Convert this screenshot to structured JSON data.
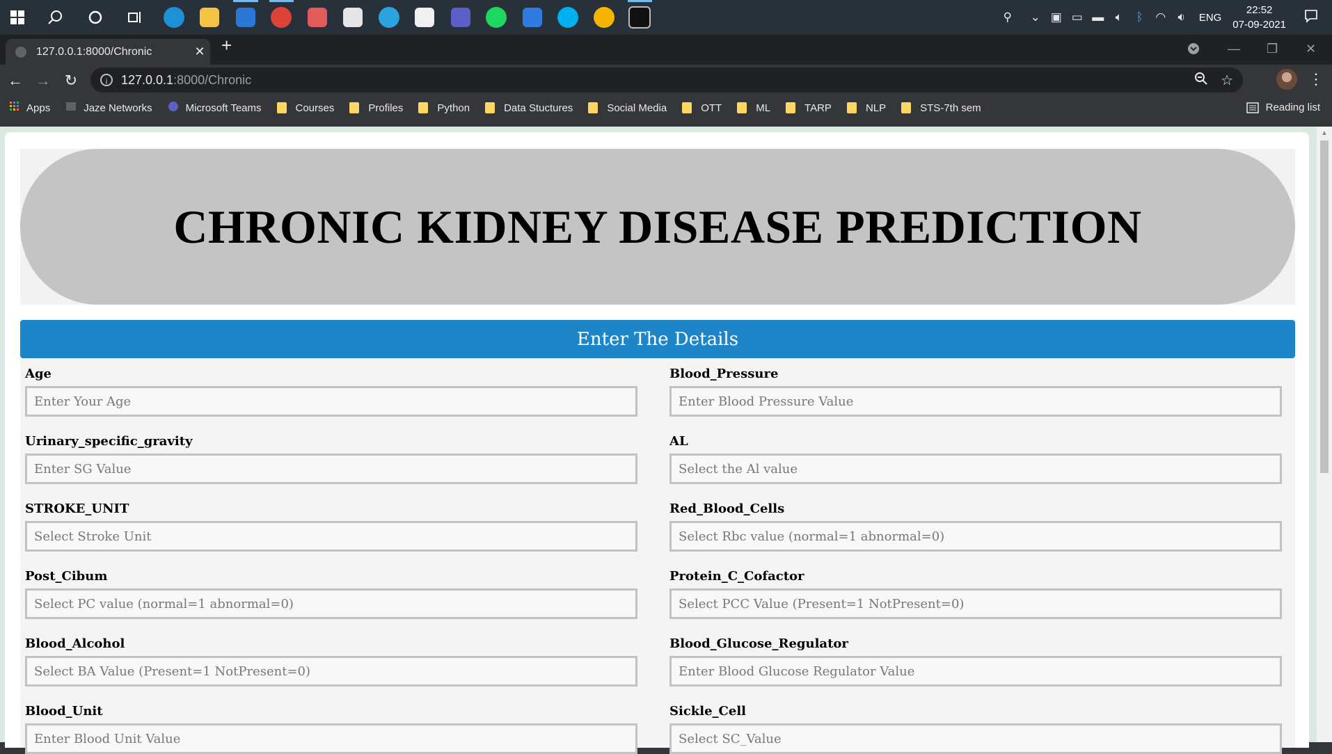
{
  "taskbar": {
    "apps": [
      {
        "name": "edge",
        "color": "#1e90d6"
      },
      {
        "name": "file-explorer",
        "color": "#f2c344"
      },
      {
        "name": "mail",
        "color": "#2a78d6"
      },
      {
        "name": "chrome",
        "color": "#db4437"
      },
      {
        "name": "paint",
        "color": "#e35a5a"
      },
      {
        "name": "settings",
        "color": "#e6e6e6"
      },
      {
        "name": "telegram",
        "color": "#2aa3df"
      },
      {
        "name": "store",
        "color": "#f0f0f0"
      },
      {
        "name": "teams",
        "color": "#5b5fc7"
      },
      {
        "name": "spotify",
        "color": "#1ed760"
      },
      {
        "name": "todo",
        "color": "#2f7be0"
      },
      {
        "name": "skype",
        "color": "#00aff0"
      },
      {
        "name": "weather",
        "color": "#f5b400"
      },
      {
        "name": "terminal",
        "color": "#111111"
      }
    ],
    "lang": "ENG",
    "time": "22:52",
    "date": "07-09-2021"
  },
  "browser": {
    "tab_title": "127.0.0.1:8000/Chronic",
    "url_host": "127.0.0.1",
    "url_rest": ":8000/Chronic",
    "bookmarks": [
      {
        "label": "Apps",
        "type": "apps"
      },
      {
        "label": "Jaze Networks",
        "type": "site"
      },
      {
        "label": "Microsoft Teams",
        "type": "site"
      },
      {
        "label": "Courses",
        "type": "folder"
      },
      {
        "label": "Profiles",
        "type": "folder"
      },
      {
        "label": "Python",
        "type": "folder"
      },
      {
        "label": "Data Stuctures",
        "type": "folder"
      },
      {
        "label": "Social Media",
        "type": "folder"
      },
      {
        "label": "OTT",
        "type": "folder"
      },
      {
        "label": "ML",
        "type": "folder"
      },
      {
        "label": "TARP",
        "type": "folder"
      },
      {
        "label": "NLP",
        "type": "folder"
      },
      {
        "label": "STS-7th sem",
        "type": "folder"
      }
    ],
    "reading_list": "Reading list"
  },
  "page": {
    "title": "CHRONIC KIDNEY DISEASE PREDICTION",
    "section_header": "Enter The Details",
    "fields": [
      {
        "label": "Age",
        "placeholder": "Enter Your Age"
      },
      {
        "label": "Blood_Pressure",
        "placeholder": "Enter Blood Pressure Value"
      },
      {
        "label": "Urinary_specific_gravity",
        "placeholder": "Enter SG Value"
      },
      {
        "label": "AL",
        "placeholder": "Select the Al value"
      },
      {
        "label": "STROKE_UNIT",
        "placeholder": "Select Stroke Unit"
      },
      {
        "label": "Red_Blood_Cells",
        "placeholder": "Select Rbc value (normal=1 abnormal=0)"
      },
      {
        "label": "Post_Cibum",
        "placeholder": "Select PC value (normal=1 abnormal=0)"
      },
      {
        "label": "Protein_C_Cofactor",
        "placeholder": "Select PCC Value (Present=1 NotPresent=0)"
      },
      {
        "label": "Blood_Alcohol",
        "placeholder": "Select BA Value (Present=1 NotPresent=0)"
      },
      {
        "label": "Blood_Glucose_Regulator",
        "placeholder": "Enter Blood Glucose Regulator Value"
      },
      {
        "label": "Blood_Unit",
        "placeholder": "Enter Blood Unit Value"
      },
      {
        "label": "Sickle_Cell",
        "placeholder": "Select SC_Value"
      }
    ]
  }
}
